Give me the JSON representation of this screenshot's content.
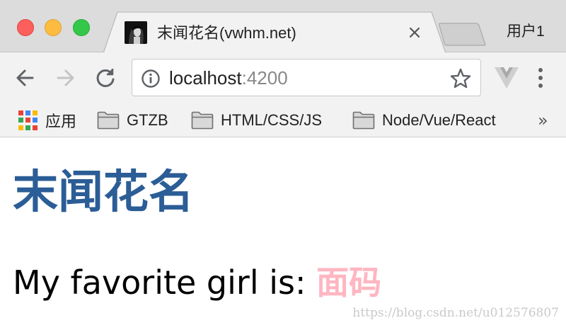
{
  "window": {
    "controls": [
      "close",
      "minimize",
      "maximize"
    ]
  },
  "tab": {
    "title": "末闻花名(vwhm.net)",
    "close_label": "×"
  },
  "profile": {
    "name": "用户1"
  },
  "toolbar": {
    "url_host": "localhost",
    "url_port": ":4200"
  },
  "bookmarks": {
    "items": [
      {
        "label": "应用",
        "icon": "apps-grid-icon"
      },
      {
        "label": "GTZB",
        "icon": "folder-icon"
      },
      {
        "label": "HTML/CSS/JS",
        "icon": "folder-icon"
      },
      {
        "label": "Node/Vue/React",
        "icon": "folder-icon"
      }
    ],
    "overflow_label": "»"
  },
  "page": {
    "heading": "末闻花名",
    "line_prefix": "My favorite girl is: ",
    "line_highlight": "面码",
    "colors": {
      "heading": "#2b5d96",
      "highlight": "#ffb6c1"
    }
  },
  "watermark": {
    "text": "https://blog.csdn.net/u012576807"
  }
}
